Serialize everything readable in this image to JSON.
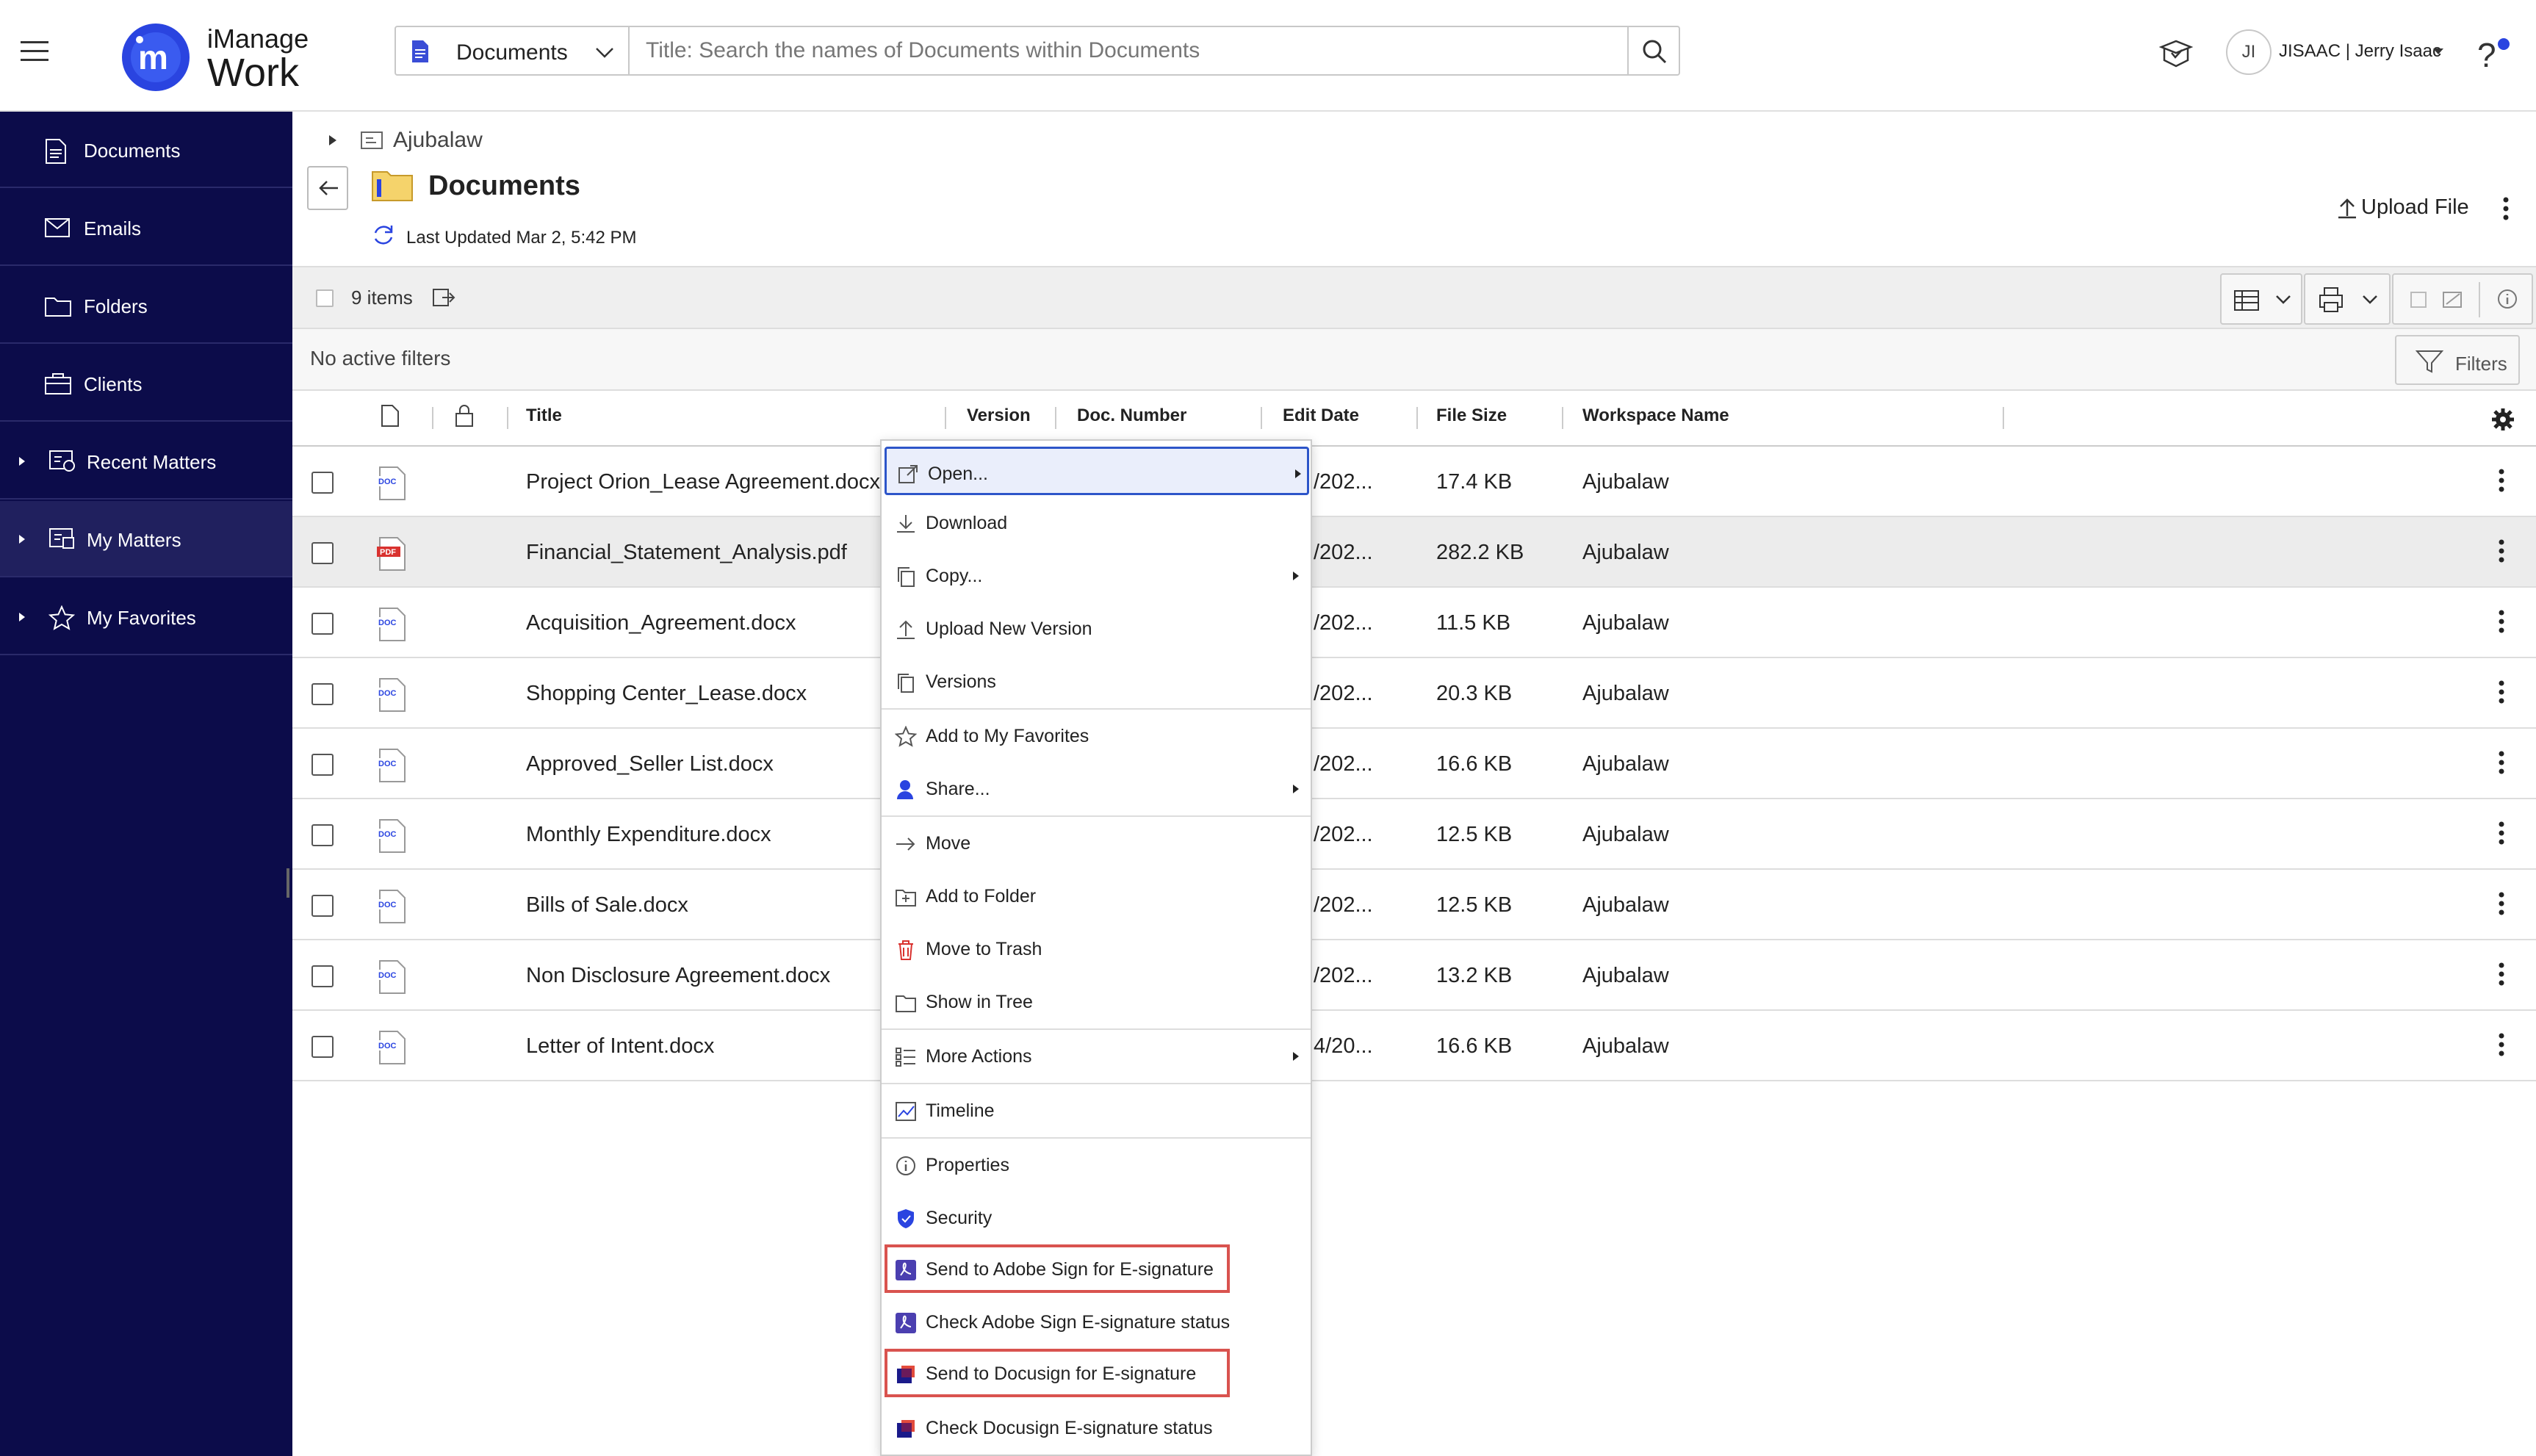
{
  "app": {
    "brand_line1": "iManage",
    "brand_line2": "Work",
    "accent_color": "#2a44e0",
    "sidebar_color": "#0c0c4a"
  },
  "search": {
    "scope": "Documents",
    "placeholder": "Title: Search the names of Documents within Documents"
  },
  "user": {
    "initials": "JI",
    "name": "JISAAC | Jerry Isaac"
  },
  "help": {
    "label": "?"
  },
  "sidebar": {
    "items": [
      {
        "label": "Documents",
        "icon": "document-icon"
      },
      {
        "label": "Emails",
        "icon": "email-icon"
      },
      {
        "label": "Folders",
        "icon": "folder-icon"
      },
      {
        "label": "Clients",
        "icon": "briefcase-icon"
      },
      {
        "label": "Recent Matters",
        "icon": "recent-matters-icon"
      },
      {
        "label": "My Matters",
        "icon": "my-matters-icon"
      },
      {
        "label": "My Favorites",
        "icon": "star-icon"
      }
    ]
  },
  "breadcrumb": {
    "label": "Ajubalaw"
  },
  "page": {
    "title": "Documents",
    "last_updated": "Last Updated Mar 2, 5:42 PM",
    "upload_label": "Upload File"
  },
  "toolbar": {
    "item_count": "9 items"
  },
  "filters": {
    "status": "No active filters",
    "button_label": "Filters"
  },
  "table": {
    "columns": [
      "Title",
      "Version",
      "Doc. Number",
      "Edit Date",
      "File Size",
      "Workspace Name"
    ],
    "rows": [
      {
        "type": "DOC",
        "title": "Project Orion_Lease Agreement.docx",
        "edit_date": "/202...",
        "size": "17.4 KB",
        "workspace": "Ajubalaw"
      },
      {
        "type": "PDF",
        "title": "Financial_Statement_Analysis.pdf",
        "edit_date": "/202...",
        "size": "282.2 KB",
        "workspace": "Ajubalaw"
      },
      {
        "type": "DOC",
        "title": "Acquisition_Agreement.docx",
        "edit_date": "/202...",
        "size": "11.5 KB",
        "workspace": "Ajubalaw"
      },
      {
        "type": "DOC",
        "title": "Shopping Center_Lease.docx",
        "edit_date": "/202...",
        "size": "20.3 KB",
        "workspace": "Ajubalaw"
      },
      {
        "type": "DOC",
        "title": "Approved_Seller List.docx",
        "edit_date": "/202...",
        "size": "16.6 KB",
        "workspace": "Ajubalaw"
      },
      {
        "type": "DOC",
        "title": "Monthly Expenditure.docx",
        "edit_date": "/202...",
        "size": "12.5 KB",
        "workspace": "Ajubalaw"
      },
      {
        "type": "DOC",
        "title": "Bills of Sale.docx",
        "edit_date": "/202...",
        "size": "12.5 KB",
        "workspace": "Ajubalaw"
      },
      {
        "type": "DOC",
        "title": "Non Disclosure Agreement.docx",
        "edit_date": "/202...",
        "size": "13.2 KB",
        "workspace": "Ajubalaw"
      },
      {
        "type": "DOC",
        "title": "Letter of Intent.docx",
        "edit_date": "4/20...",
        "size": "16.6 KB",
        "workspace": "Ajubalaw"
      }
    ]
  },
  "context_menu": {
    "items": [
      {
        "label": "Open...",
        "icon": "open-external-icon",
        "submenu": true
      },
      {
        "label": "Download",
        "icon": "download-icon"
      },
      {
        "label": "Copy...",
        "icon": "copy-icon",
        "submenu": true
      },
      {
        "label": "Upload New Version",
        "icon": "upload-icon"
      },
      {
        "label": "Versions",
        "icon": "versions-icon"
      },
      {
        "label": "Add to My Favorites",
        "icon": "star-icon"
      },
      {
        "label": "Share...",
        "icon": "share-user-icon",
        "submenu": true
      },
      {
        "label": "Move",
        "icon": "arrow-right-icon"
      },
      {
        "label": "Add to Folder",
        "icon": "add-folder-icon"
      },
      {
        "label": "Move to Trash",
        "icon": "trash-icon"
      },
      {
        "label": "Show in Tree",
        "icon": "tree-icon"
      },
      {
        "label": "More Actions",
        "icon": "list-icon",
        "submenu": true
      },
      {
        "label": "Timeline",
        "icon": "timeline-icon"
      },
      {
        "label": "Properties",
        "icon": "info-icon"
      },
      {
        "label": "Security",
        "icon": "shield-icon"
      },
      {
        "label": "Send to Adobe Sign for E-signature",
        "icon": "adobe-sign-icon"
      },
      {
        "label": "Check Adobe Sign E-signature status",
        "icon": "adobe-sign-icon"
      },
      {
        "label": "Send to Docusign for E-signature",
        "icon": "docusign-icon"
      },
      {
        "label": "Check Docusign E-signature status",
        "icon": "docusign-icon"
      }
    ]
  }
}
